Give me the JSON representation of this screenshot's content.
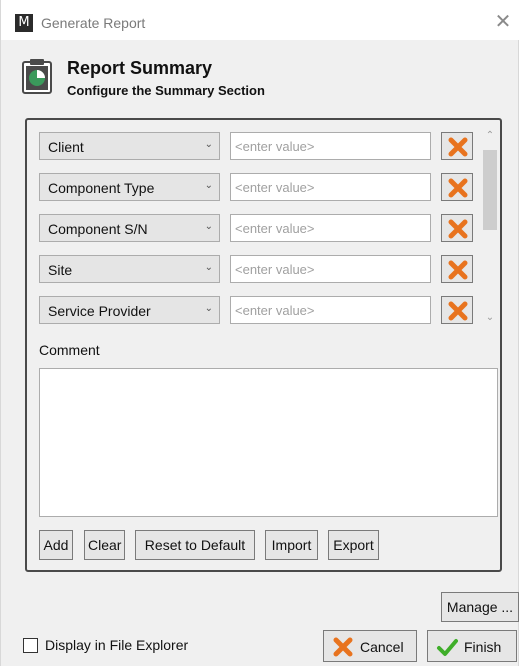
{
  "window": {
    "title": "Generate Report",
    "app_logo": "M",
    "close_glyph": "✕"
  },
  "header": {
    "icon": "clipboard-pie-chart-icon",
    "title": "Report Summary",
    "subtitle": "Configure the Summary Section"
  },
  "fields": [
    {
      "key": "Client",
      "placeholder": "<enter value>",
      "value": ""
    },
    {
      "key": "Component Type",
      "placeholder": "<enter value>",
      "value": ""
    },
    {
      "key": "Component S/N",
      "placeholder": "<enter value>",
      "value": ""
    },
    {
      "key": "Site",
      "placeholder": "<enter value>",
      "value": ""
    },
    {
      "key": "Service Provider",
      "placeholder": "<enter value>",
      "value": ""
    }
  ],
  "comment": {
    "label": "Comment",
    "value": ""
  },
  "toolbar": {
    "add": "Add",
    "clear": "Clear",
    "reset": "Reset to Default",
    "import": "Import",
    "export": "Export"
  },
  "footer": {
    "manage": "Manage ...",
    "display_in_explorer": "Display in File Explorer",
    "display_in_explorer_checked": false,
    "cancel": "Cancel",
    "finish": "Finish"
  },
  "colors": {
    "remove_icon": "#e8731e",
    "cancel_icon": "#e8731e",
    "finish_icon": "#3fae2a",
    "header_icon_accent": "#3a9a5b"
  }
}
